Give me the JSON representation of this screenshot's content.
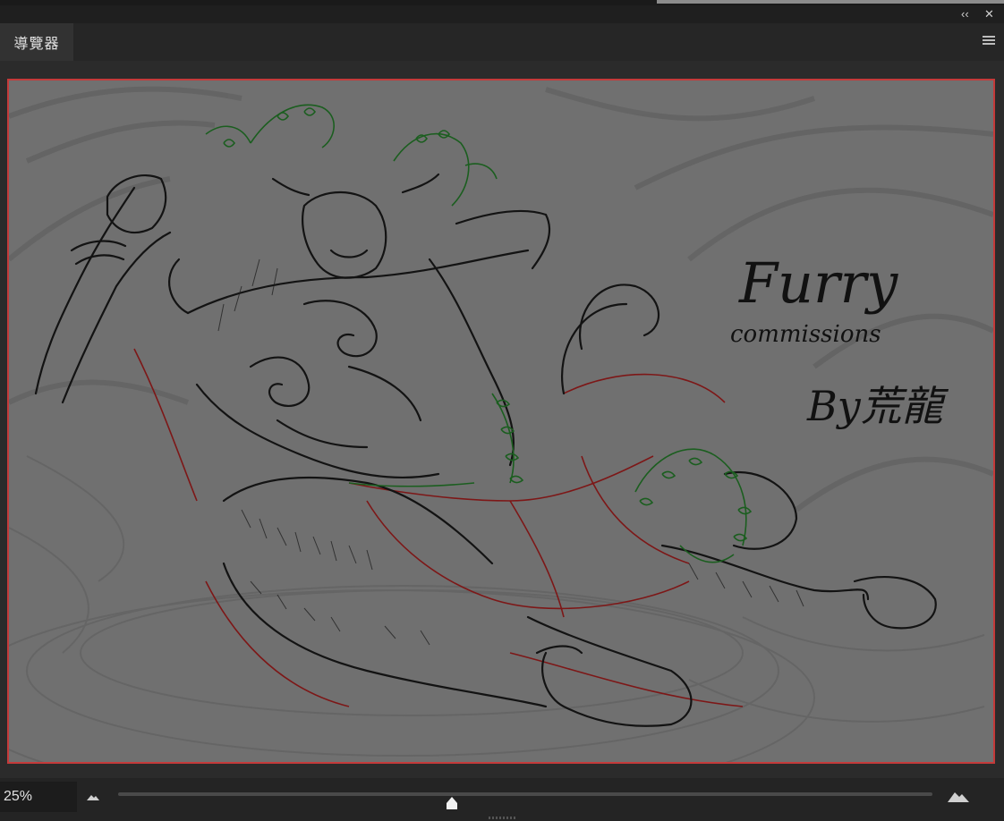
{
  "panel": {
    "tab_label": "導覽器",
    "collapse_icon": "double-chevron-left-icon",
    "close_icon": "close-icon",
    "menu_icon": "hamburger-menu-icon"
  },
  "canvas": {
    "frame_color": "#c43a3a",
    "background_color": "#808080",
    "signature_lines": [
      "Furry",
      "commissions",
      "By荒龍"
    ]
  },
  "zoom": {
    "value": "25%",
    "slider_level": 0.41,
    "zoom_out_icon": "small-mountain-icon",
    "zoom_in_icon": "large-mountain-icon"
  }
}
